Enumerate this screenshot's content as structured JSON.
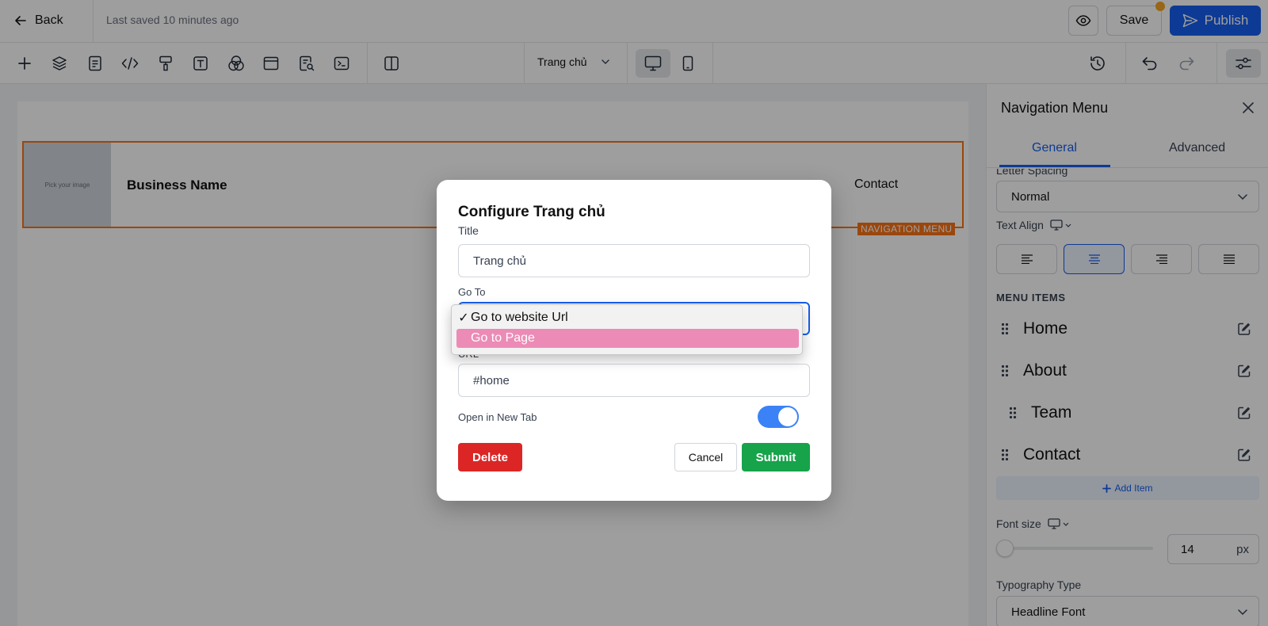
{
  "topbar": {
    "back_label": "Back",
    "saved_text": "Last saved 10 minutes ago",
    "save_label": "Save",
    "publish_label": "Publish"
  },
  "toolbar": {
    "page_select": "Trang chủ"
  },
  "canvas": {
    "image_placeholder": "Pick your image",
    "business_name": "Business Name",
    "nav_link": "Contact",
    "section_tag": "NAVIGATION MENU"
  },
  "panel": {
    "title": "Navigation Menu",
    "tabs": [
      {
        "label": "General",
        "active": true
      },
      {
        "label": "Advanced",
        "active": false
      }
    ],
    "letter_spacing_label": "Letter Spacing",
    "letter_spacing_value": "Normal",
    "text_align_label": "Text Align",
    "text_align_active": "center",
    "menu_items_heading": "MENU ITEMS",
    "menu_items": [
      {
        "label": "Home"
      },
      {
        "label": "About"
      },
      {
        "label": "Team"
      },
      {
        "label": "Contact"
      }
    ],
    "add_item_label": "Add Item",
    "font_size_label": "Font size",
    "font_size_value": "14",
    "font_size_unit": "px",
    "typography_label": "Typography Type",
    "typography_value": "Headline Font"
  },
  "modal": {
    "title": "Configure Trang chủ",
    "title_label": "Title",
    "title_value": "Trang chủ",
    "goto_label": "Go To",
    "url_label": "URL",
    "url_value": "#home",
    "new_tab_label": "Open in New Tab",
    "new_tab_on": true,
    "delete_label": "Delete",
    "cancel_label": "Cancel",
    "submit_label": "Submit"
  },
  "dropdown": {
    "options": [
      {
        "check": "✓",
        "label": "Go to website Url",
        "selected": true
      },
      {
        "check": "",
        "label": "Go to Page",
        "highlighted": true
      }
    ]
  },
  "colors": {
    "accent": "#155eef",
    "section_outline": "#f97316",
    "delete": "#dc2626",
    "submit": "#16a34a",
    "toggle_on": "#3b82f6",
    "dropdown_hover": "#ec8bb6"
  }
}
